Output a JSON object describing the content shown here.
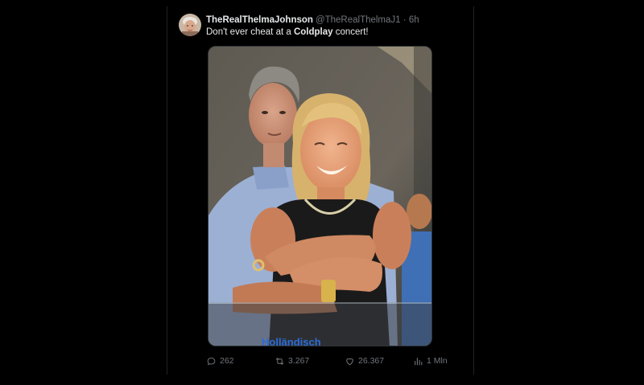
{
  "tweet": {
    "display_name": "TheRealThelmaJohnson",
    "handle": "@TheRealThelmaJ1",
    "separator": "·",
    "time": "6h",
    "text_before": "Don't ever cheat at a ",
    "text_bold": "Coldplay",
    "text_after": " concert!"
  },
  "stats": {
    "replies": "262",
    "reposts": "3.267",
    "likes": "26.367",
    "views": "1 Mln"
  },
  "media": {
    "overlay_text": "Holländisch"
  },
  "icons": {
    "reply": "reply-icon",
    "repost": "repost-icon",
    "like": "like-icon",
    "views": "views-icon"
  },
  "colors": {
    "background": "#000000",
    "text_primary": "#e7e9ea",
    "text_secondary": "#71767b"
  }
}
